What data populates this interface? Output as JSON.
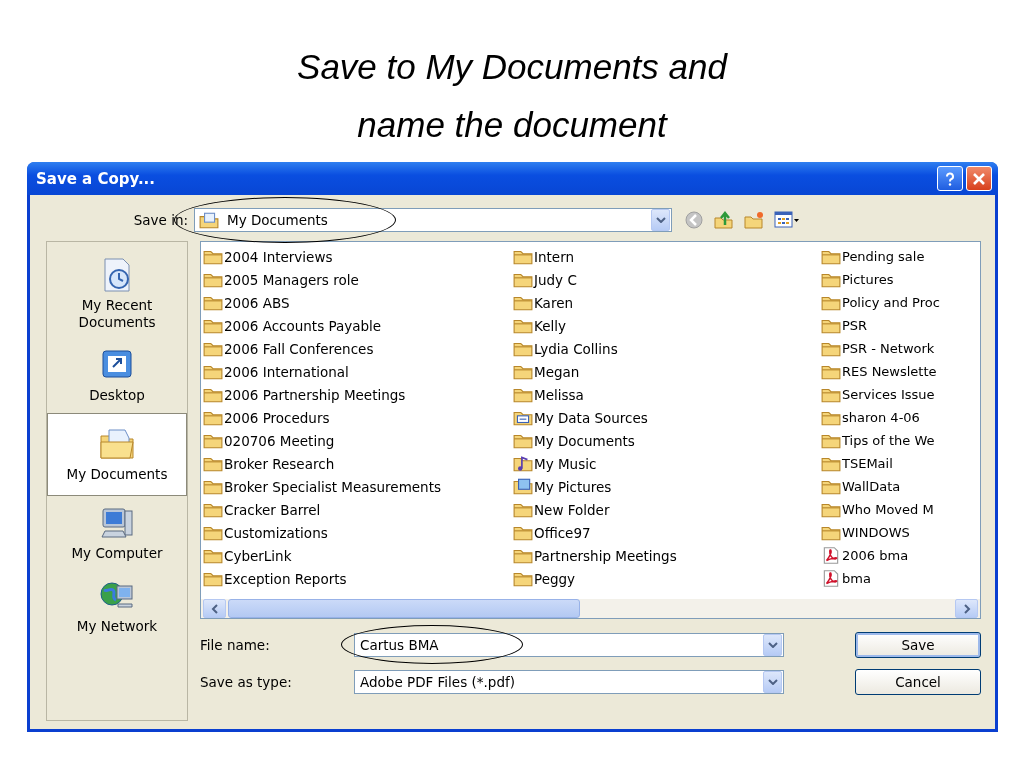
{
  "slide_title": [
    "Save to My Documents and",
    "name the document"
  ],
  "window": {
    "title": "Save a Copy..."
  },
  "save_in": {
    "label": "Save in:",
    "value": "My Documents",
    "circled": true
  },
  "places": [
    {
      "kind": "recent",
      "label": "My Recent Documents",
      "selected": false
    },
    {
      "kind": "desktop",
      "label": "Desktop",
      "selected": false
    },
    {
      "kind": "documents",
      "label": "My Documents",
      "selected": true
    },
    {
      "kind": "computer",
      "label": "My Computer",
      "selected": false
    },
    {
      "kind": "network",
      "label": "My Network",
      "selected": false
    }
  ],
  "files": [
    [
      {
        "kind": "folder",
        "name": "2004 Interviews"
      },
      {
        "kind": "folder",
        "name": "2005 Managers role"
      },
      {
        "kind": "folder",
        "name": "2006 ABS"
      },
      {
        "kind": "folder",
        "name": "2006 Accounts Payable"
      },
      {
        "kind": "folder",
        "name": "2006 Fall Conferences"
      },
      {
        "kind": "folder",
        "name": "2006 International"
      },
      {
        "kind": "folder",
        "name": "2006 Partnership Meetings"
      },
      {
        "kind": "folder",
        "name": "2006 Procedurs"
      },
      {
        "kind": "folder",
        "name": "020706 Meeting"
      },
      {
        "kind": "folder",
        "name": "Broker Research"
      },
      {
        "kind": "folder",
        "name": "Broker Specialist Measurements"
      },
      {
        "kind": "folder",
        "name": "Cracker Barrel"
      },
      {
        "kind": "folder",
        "name": "Customizations"
      },
      {
        "kind": "folder",
        "name": "CyberLink"
      },
      {
        "kind": "folder",
        "name": "Exception Reports"
      }
    ],
    [
      {
        "kind": "folder",
        "name": "Intern"
      },
      {
        "kind": "folder",
        "name": "Judy C"
      },
      {
        "kind": "folder",
        "name": "Karen"
      },
      {
        "kind": "folder",
        "name": "Kelly"
      },
      {
        "kind": "folder",
        "name": "Lydia Collins"
      },
      {
        "kind": "folder",
        "name": "Megan"
      },
      {
        "kind": "folder",
        "name": "Melissa"
      },
      {
        "kind": "datasource",
        "name": "My Data Sources"
      },
      {
        "kind": "folder",
        "name": "My Documents"
      },
      {
        "kind": "music",
        "name": "My Music"
      },
      {
        "kind": "pictures",
        "name": "My Pictures"
      },
      {
        "kind": "folder",
        "name": "New Folder"
      },
      {
        "kind": "folder",
        "name": "Office97"
      },
      {
        "kind": "folder",
        "name": "Partnership Meetings"
      },
      {
        "kind": "folder",
        "name": "Peggy"
      }
    ],
    [
      {
        "kind": "folder",
        "name": "Pending sale"
      },
      {
        "kind": "folder",
        "name": "Pictures"
      },
      {
        "kind": "folder",
        "name": "Policy and Proc"
      },
      {
        "kind": "folder",
        "name": "PSR"
      },
      {
        "kind": "folder",
        "name": "PSR - Network"
      },
      {
        "kind": "folder",
        "name": "RES Newslette"
      },
      {
        "kind": "folder",
        "name": "Services Issue"
      },
      {
        "kind": "folder",
        "name": "sharon 4-06"
      },
      {
        "kind": "folder",
        "name": "Tips of the We"
      },
      {
        "kind": "folder",
        "name": "TSEMail"
      },
      {
        "kind": "folder",
        "name": "WallData"
      },
      {
        "kind": "folder",
        "name": "Who Moved M"
      },
      {
        "kind": "folder",
        "name": "WINDOWS"
      },
      {
        "kind": "pdf",
        "name": "2006 bma"
      },
      {
        "kind": "pdf",
        "name": "bma"
      }
    ]
  ],
  "file_name": {
    "label": "File name:",
    "value": "Cartus BMA",
    "circled": true
  },
  "save_as_type": {
    "label": "Save as type:",
    "value": "Adobe PDF Files (*.pdf)"
  },
  "buttons": [
    {
      "kind": "default",
      "label": "Save"
    },
    {
      "kind": "normal",
      "label": "Cancel"
    }
  ]
}
